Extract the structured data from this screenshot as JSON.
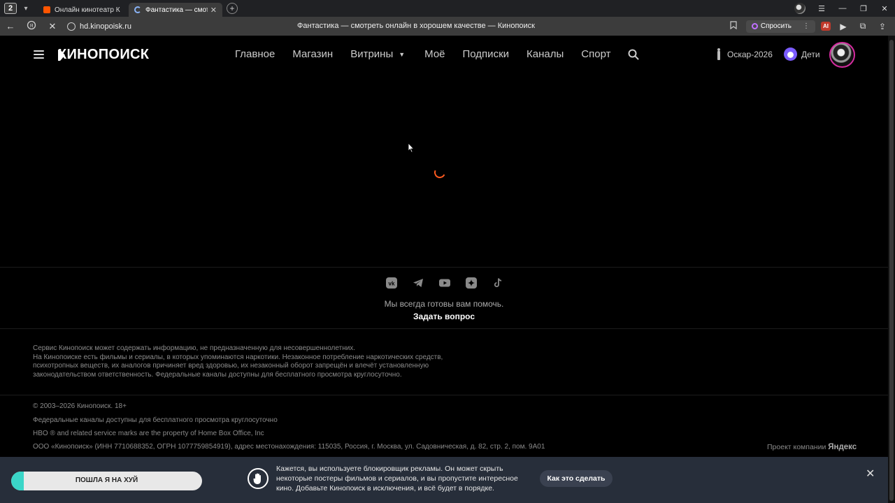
{
  "browser": {
    "tab_count": "2",
    "tabs": [
      {
        "title": "Онлайн кинотеатр Кинопоиск"
      },
      {
        "title": "Фантастика — смотреть онлайн в хорошем качестве — Кинопоиск"
      }
    ],
    "url": "hd.kinopoisk.ru",
    "page_title": "Фантастика — смотреть онлайн в хорошем качестве — Кинопоиск",
    "ask_label": "Спросить",
    "ai_badge": "AI"
  },
  "header": {
    "logo": "КИНОПОИСК",
    "nav": [
      {
        "label": "Главное"
      },
      {
        "label": "Магазин"
      },
      {
        "label": "Витрины"
      },
      {
        "label": "Моё"
      },
      {
        "label": "Подписки"
      },
      {
        "label": "Каналы"
      },
      {
        "label": "Спорт"
      }
    ],
    "oscar_label": "Оскар-2026",
    "kids_label": "Дети"
  },
  "footer": {
    "help_text": "Мы всегда готовы вам помочь.",
    "ask_question": "Задать вопрос",
    "disclaimer": [
      "Сервис Кинопоиск может содержать информацию, не предназначенную для несовершеннолетних.",
      "На Кинопоиске есть фильмы и сериалы, в которых упоминаются наркотики. Незаконное потребление наркотических средств,",
      "психотропных веществ, их аналогов причиняет вред здоровью, их незаконный оборот запрещён и влечёт установленную",
      "законодательством ответственность. Федеральные каналы доступны для бесплатного просмотра круглосуточно."
    ],
    "copyright": "© 2003–2026 Кинопоиск. 18+",
    "federal": "Федеральные каналы доступны для бесплатного просмотра круглосуточно",
    "hbo": "HBO ® and related service marks are the property of Home Box Office, Inc",
    "legal": "ООО «Кинопоиск» (ИНН 7710688352, ОГРН 1077759854919), адрес местонахождения: 115035, Россия, г. Москва, ул. Садовническая, д. 82, стр. 2, пом. 9А01",
    "project_prefix": "Проект компании",
    "project_company": "Яндекс"
  },
  "adblock_banner": {
    "pill_text": "ПОШЛА Я НА ХУЙ",
    "text_lines": [
      "Кажется, вы используете блокировщик рекламы. Он может скрыть",
      "некоторые постеры фильмов и сериалов, и вы пропустите интересное",
      "кино. Добавьте Кинопоиск в исключения, и всё будет в порядке."
    ],
    "button_label": "Как это сделать"
  },
  "colors": {
    "background": "#000000",
    "accent_loader": "#ff5a1f",
    "banner_bg": "#272e3a",
    "profile_ring": "#d52ca0"
  }
}
